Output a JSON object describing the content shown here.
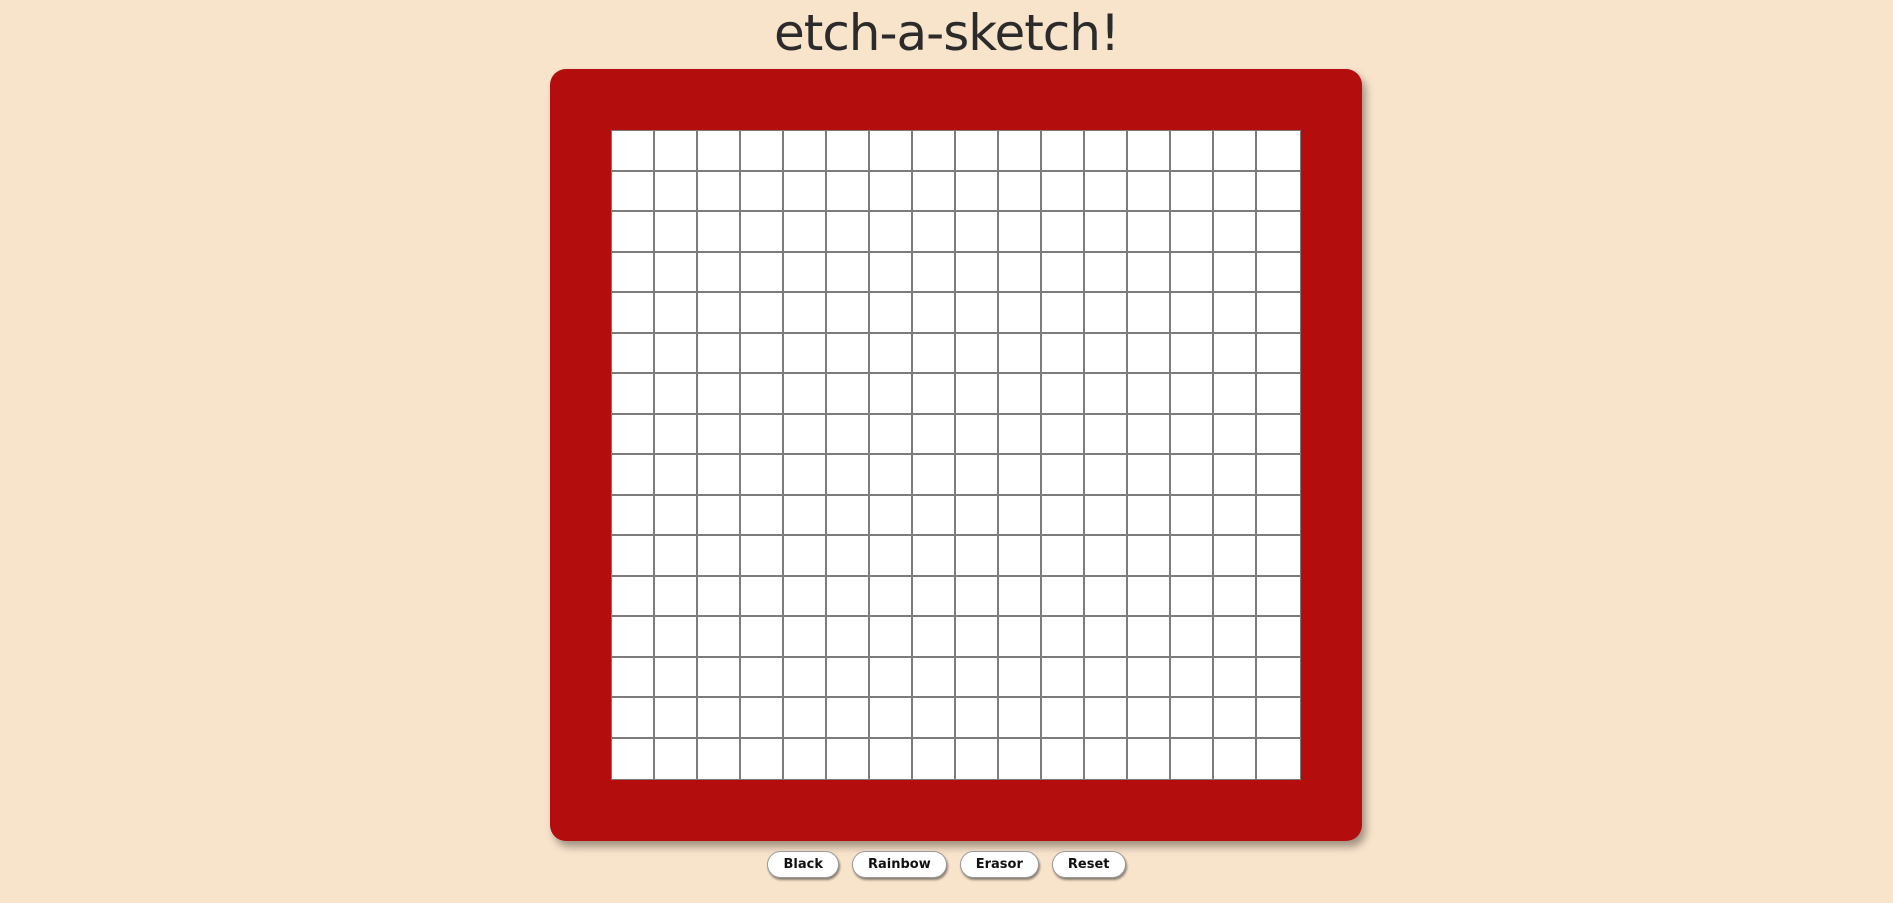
{
  "app": {
    "title": "etch-a-sketch!"
  },
  "board": {
    "frame_color": "#b30d0e",
    "cell_color": "#ffffff",
    "grid_line_color": "#7c7c7c",
    "rows": 16,
    "columns": 16
  },
  "controls": {
    "black_label": "Black",
    "rainbow_label": "Rainbow",
    "erasor_label": "Erasor",
    "reset_label": "Reset"
  },
  "colors": {
    "background": "#f8e3cb",
    "title_text": "#2b2b2b"
  }
}
